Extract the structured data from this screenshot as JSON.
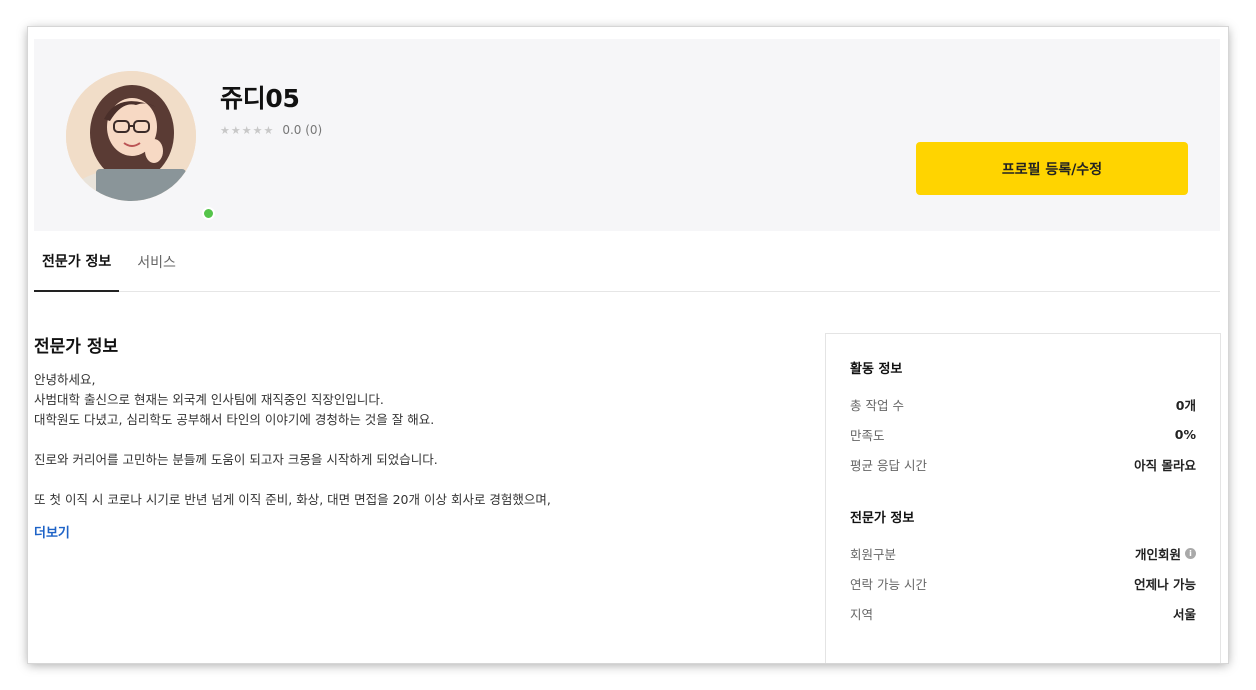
{
  "profile": {
    "name": "쥬디05",
    "stars": "★★★★★",
    "rating_text": "0.0 (0)",
    "edit_button_label": "프로필 등록/수정"
  },
  "tabs": [
    {
      "label": "전문가 정보",
      "active": true
    },
    {
      "label": "서비스",
      "active": false
    }
  ],
  "main": {
    "title": "전문가 정보",
    "lines": [
      "안녕하세요,",
      "사범대학 출신으로 현재는 외국계 인사팀에 재직중인 직장인입니다.",
      "대학원도 다녔고, 심리학도 공부해서 타인의 이야기에 경청하는 것을 잘 해요.",
      "",
      "진로와 커리어를 고민하는 분들께 도움이 되고자 크몽을 시작하게 되었습니다.",
      "",
      "또 첫 이직 시 코로나 시기로 반년 넘게 이직 준비, 화상, 대면 면접을 20개 이상 회사로 경험했으며,"
    ],
    "more_label": "더보기"
  },
  "sidebar": {
    "activity": {
      "title": "활동 정보",
      "rows": [
        {
          "label": "총 작업 수",
          "value": "0개"
        },
        {
          "label": "만족도",
          "value": "0%"
        },
        {
          "label": "평균 응답 시간",
          "value": "아직 몰라요"
        }
      ]
    },
    "expert": {
      "title": "전문가 정보",
      "rows": [
        {
          "label": "회원구분",
          "value": "개인회원"
        },
        {
          "label": "연락 가능 시간",
          "value": "언제나 가능"
        },
        {
          "label": "지역",
          "value": "서울"
        }
      ]
    }
  },
  "icons": {
    "info": "info-icon",
    "online": "online-status-dot"
  },
  "colors": {
    "accent_button": "#ffd400",
    "link": "#1e63c7",
    "online": "#55c44a"
  }
}
